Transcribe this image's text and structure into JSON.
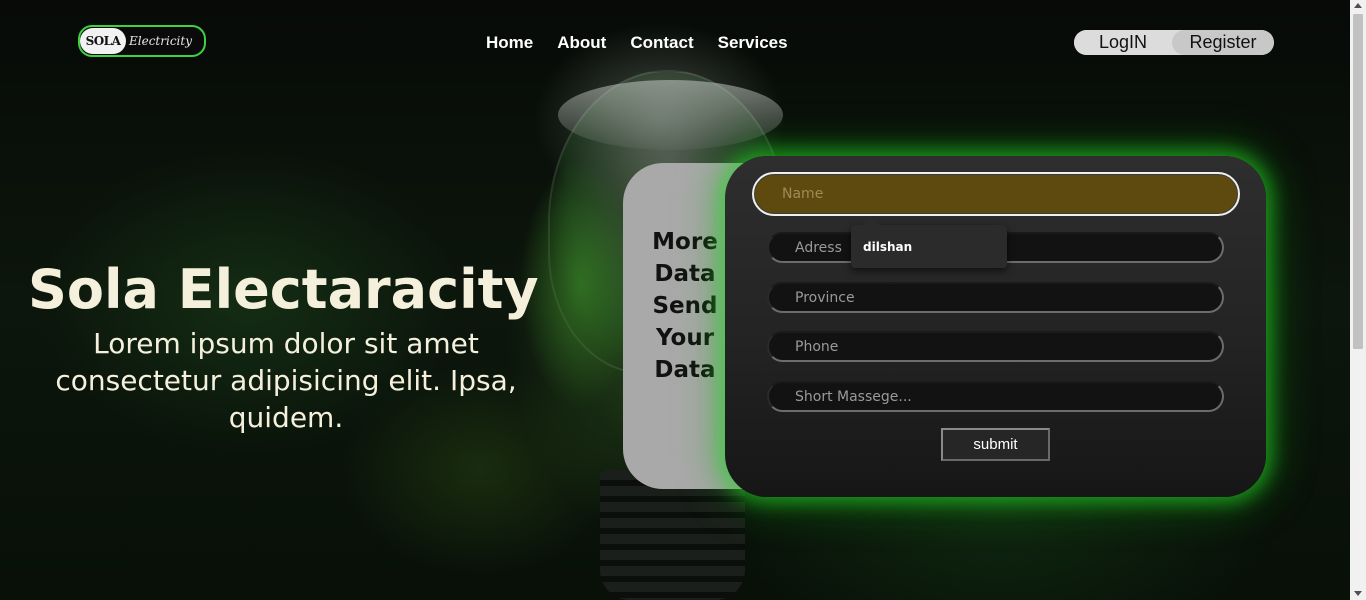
{
  "header": {
    "logo": {
      "mark": "SOLA",
      "text": "Electricity"
    },
    "nav": [
      {
        "label": "Home"
      },
      {
        "label": "About"
      },
      {
        "label": "Contact"
      },
      {
        "label": "Services"
      }
    ],
    "auth": {
      "login_label": "LogIN",
      "register_label": "Register"
    }
  },
  "hero": {
    "title": "Sola Electaracity",
    "subtitle": "Lorem ipsum dolor sit amet consectetur adipisicing elit. Ipsa, quidem."
  },
  "side_card": {
    "lines": [
      "More",
      "Data",
      "Send",
      "Your",
      "Data"
    ]
  },
  "form": {
    "name": {
      "placeholder": "Name",
      "value": ""
    },
    "address": {
      "placeholder": "Adress",
      "value": ""
    },
    "province": {
      "placeholder": "Province",
      "value": ""
    },
    "phone": {
      "placeholder": "Phone",
      "value": ""
    },
    "message": {
      "placeholder": "Short Massege...",
      "value": ""
    },
    "submit_label": "submit",
    "autocomplete": {
      "suggestion": "dilshan"
    }
  },
  "colors": {
    "accent_glow": "#28dc28",
    "hero_text": "#f5f0dc",
    "name_field_bg": "#5e4a0f",
    "side_card_bg": "#a9a9a9"
  }
}
